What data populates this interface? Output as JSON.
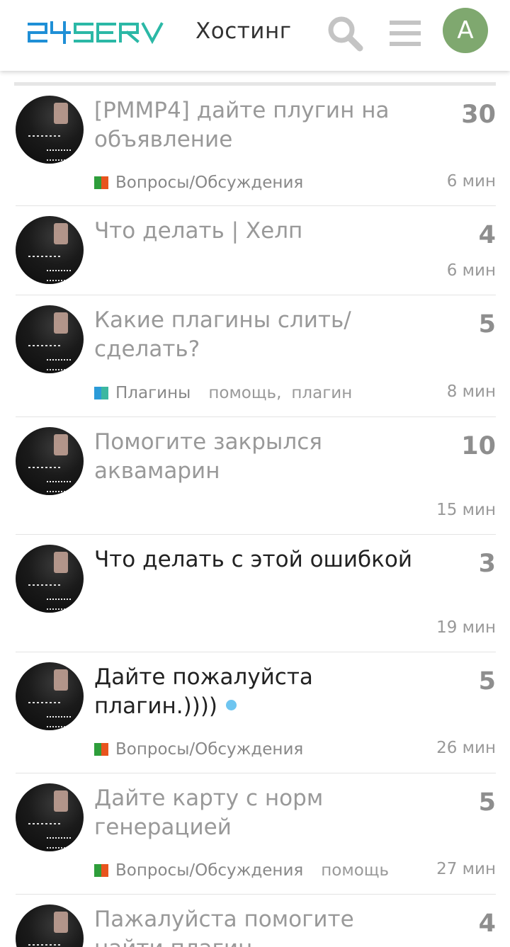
{
  "header": {
    "logo_text": "24SERV",
    "title": "Хостинг",
    "search_icon": "search-icon",
    "menu_icon": "hamburger-menu-icon",
    "avatar_letter": "A",
    "avatar_color": "#7fa86f"
  },
  "colors": {
    "logo_blue": "#1f8fd6",
    "logo_teal": "#2bb8a6",
    "category_green": "#2e9e3b",
    "category_orange": "#e8541e",
    "category_blue": "#2b9bd8",
    "category_teal": "#3bb7a0",
    "unread_dot": "#6ec5f0"
  },
  "topics": [
    {
      "title": "[PMMP4] дайте плугин на объявление",
      "posts": "30",
      "time": "6 мин",
      "category": "Вопросы/Обсуждения",
      "tags": []
    },
    {
      "title": "Что делать | Хелп",
      "posts": "4",
      "time": "6 мин",
      "category": "",
      "tags": []
    },
    {
      "title": "Какие плагины слить/сделать?",
      "posts": "5",
      "time": "8 мин",
      "category": "Плагины",
      "tags": [
        "помощь,",
        "плагин"
      ]
    },
    {
      "title": "Помогите закрылся аквамарин",
      "posts": "10",
      "time": "15 мин",
      "category": "",
      "tags": []
    },
    {
      "title": "Что делать с этой ошибкой",
      "posts": "3",
      "time": "19 мин",
      "category": "",
      "tags": []
    },
    {
      "title": "Дайте пожалуйста плагин.))))",
      "posts": "5",
      "time": "26 мин",
      "category": "Вопросы/Обсуждения",
      "tags": []
    },
    {
      "title": "Дайте карту с норм генерацией",
      "posts": "5",
      "time": "27 мин",
      "category": "Вопросы/Обсуждения",
      "tags": [
        "помощь"
      ]
    },
    {
      "title": "Пажалуйста помогите найти плагин",
      "posts": "4",
      "time": "",
      "category": "",
      "tags": []
    }
  ]
}
